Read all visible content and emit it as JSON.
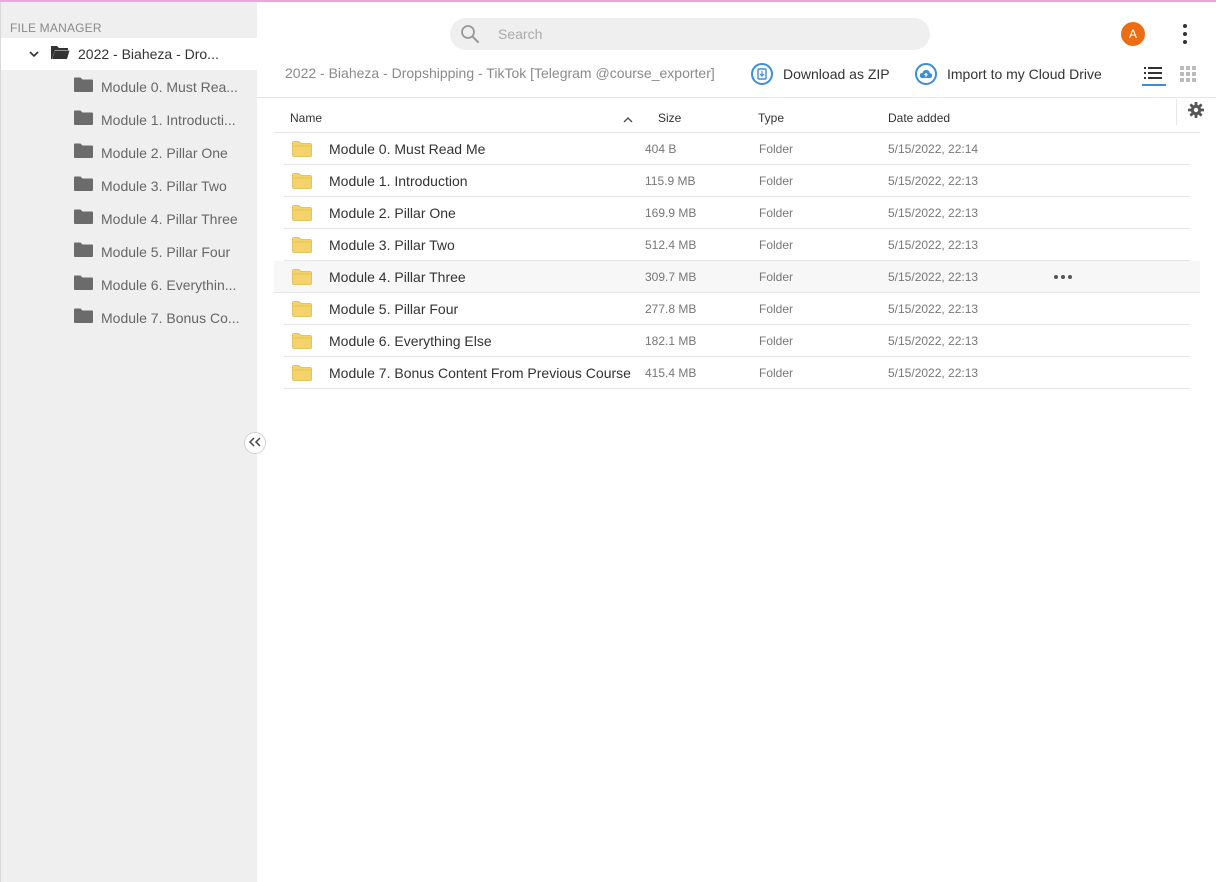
{
  "sidebar": {
    "title": "FILE MANAGER",
    "root": {
      "label": "2022 - Biaheza - Dro..."
    },
    "items": [
      {
        "label": "Module 0. Must Rea..."
      },
      {
        "label": "Module 1. Introducti..."
      },
      {
        "label": "Module 2. Pillar One"
      },
      {
        "label": "Module 3. Pillar Two"
      },
      {
        "label": "Module 4. Pillar Three"
      },
      {
        "label": "Module 5. Pillar Four"
      },
      {
        "label": "Module 6. Everythin..."
      },
      {
        "label": "Module 7. Bonus Co..."
      }
    ]
  },
  "header": {
    "search_placeholder": "Search",
    "avatar_initial": "A",
    "breadcrumb": "2022 - Biaheza - Dropshipping - TikTok [Telegram @course_exporter]",
    "download_label": "Download as ZIP",
    "import_label": "Import to my Cloud Drive"
  },
  "table": {
    "columns": {
      "name": "Name",
      "size": "Size",
      "type": "Type",
      "date": "Date added"
    },
    "rows": [
      {
        "name": "Module 0. Must Read Me",
        "size": "404 B",
        "type": "Folder",
        "date": "5/15/2022, 22:14"
      },
      {
        "name": "Module 1. Introduction",
        "size": "115.9 MB",
        "type": "Folder",
        "date": "5/15/2022, 22:13"
      },
      {
        "name": "Module 2. Pillar One",
        "size": "169.9 MB",
        "type": "Folder",
        "date": "5/15/2022, 22:13"
      },
      {
        "name": "Module 3. Pillar Two",
        "size": "512.4 MB",
        "type": "Folder",
        "date": "5/15/2022, 22:13"
      },
      {
        "name": "Module 4. Pillar Three",
        "size": "309.7 MB",
        "type": "Folder",
        "date": "5/15/2022, 22:13"
      },
      {
        "name": "Module 5. Pillar Four",
        "size": "277.8 MB",
        "type": "Folder",
        "date": "5/15/2022, 22:13"
      },
      {
        "name": "Module 6. Everything Else",
        "size": "182.1 MB",
        "type": "Folder",
        "date": "5/15/2022, 22:13"
      },
      {
        "name": "Module 7. Bonus Content From Previous Course",
        "size": "415.4 MB",
        "type": "Folder",
        "date": "5/15/2022, 22:13"
      }
    ]
  },
  "colors": {
    "accent": "#3a8fd6",
    "avatar": "#ec6d13",
    "folder_yellow": "#f5d36b",
    "sidebar_bg": "#efefef"
  },
  "icons": {
    "search": "search-icon",
    "folder": "folder-icon",
    "download": "download-zip-icon",
    "import": "cloud-upload-icon",
    "list_view": "list-view-icon",
    "grid_view": "grid-view-icon",
    "settings": "gear-icon",
    "more": "more-horizontal-icon",
    "collapse": "double-chevron-left-icon",
    "menu": "kebab-menu-icon"
  }
}
